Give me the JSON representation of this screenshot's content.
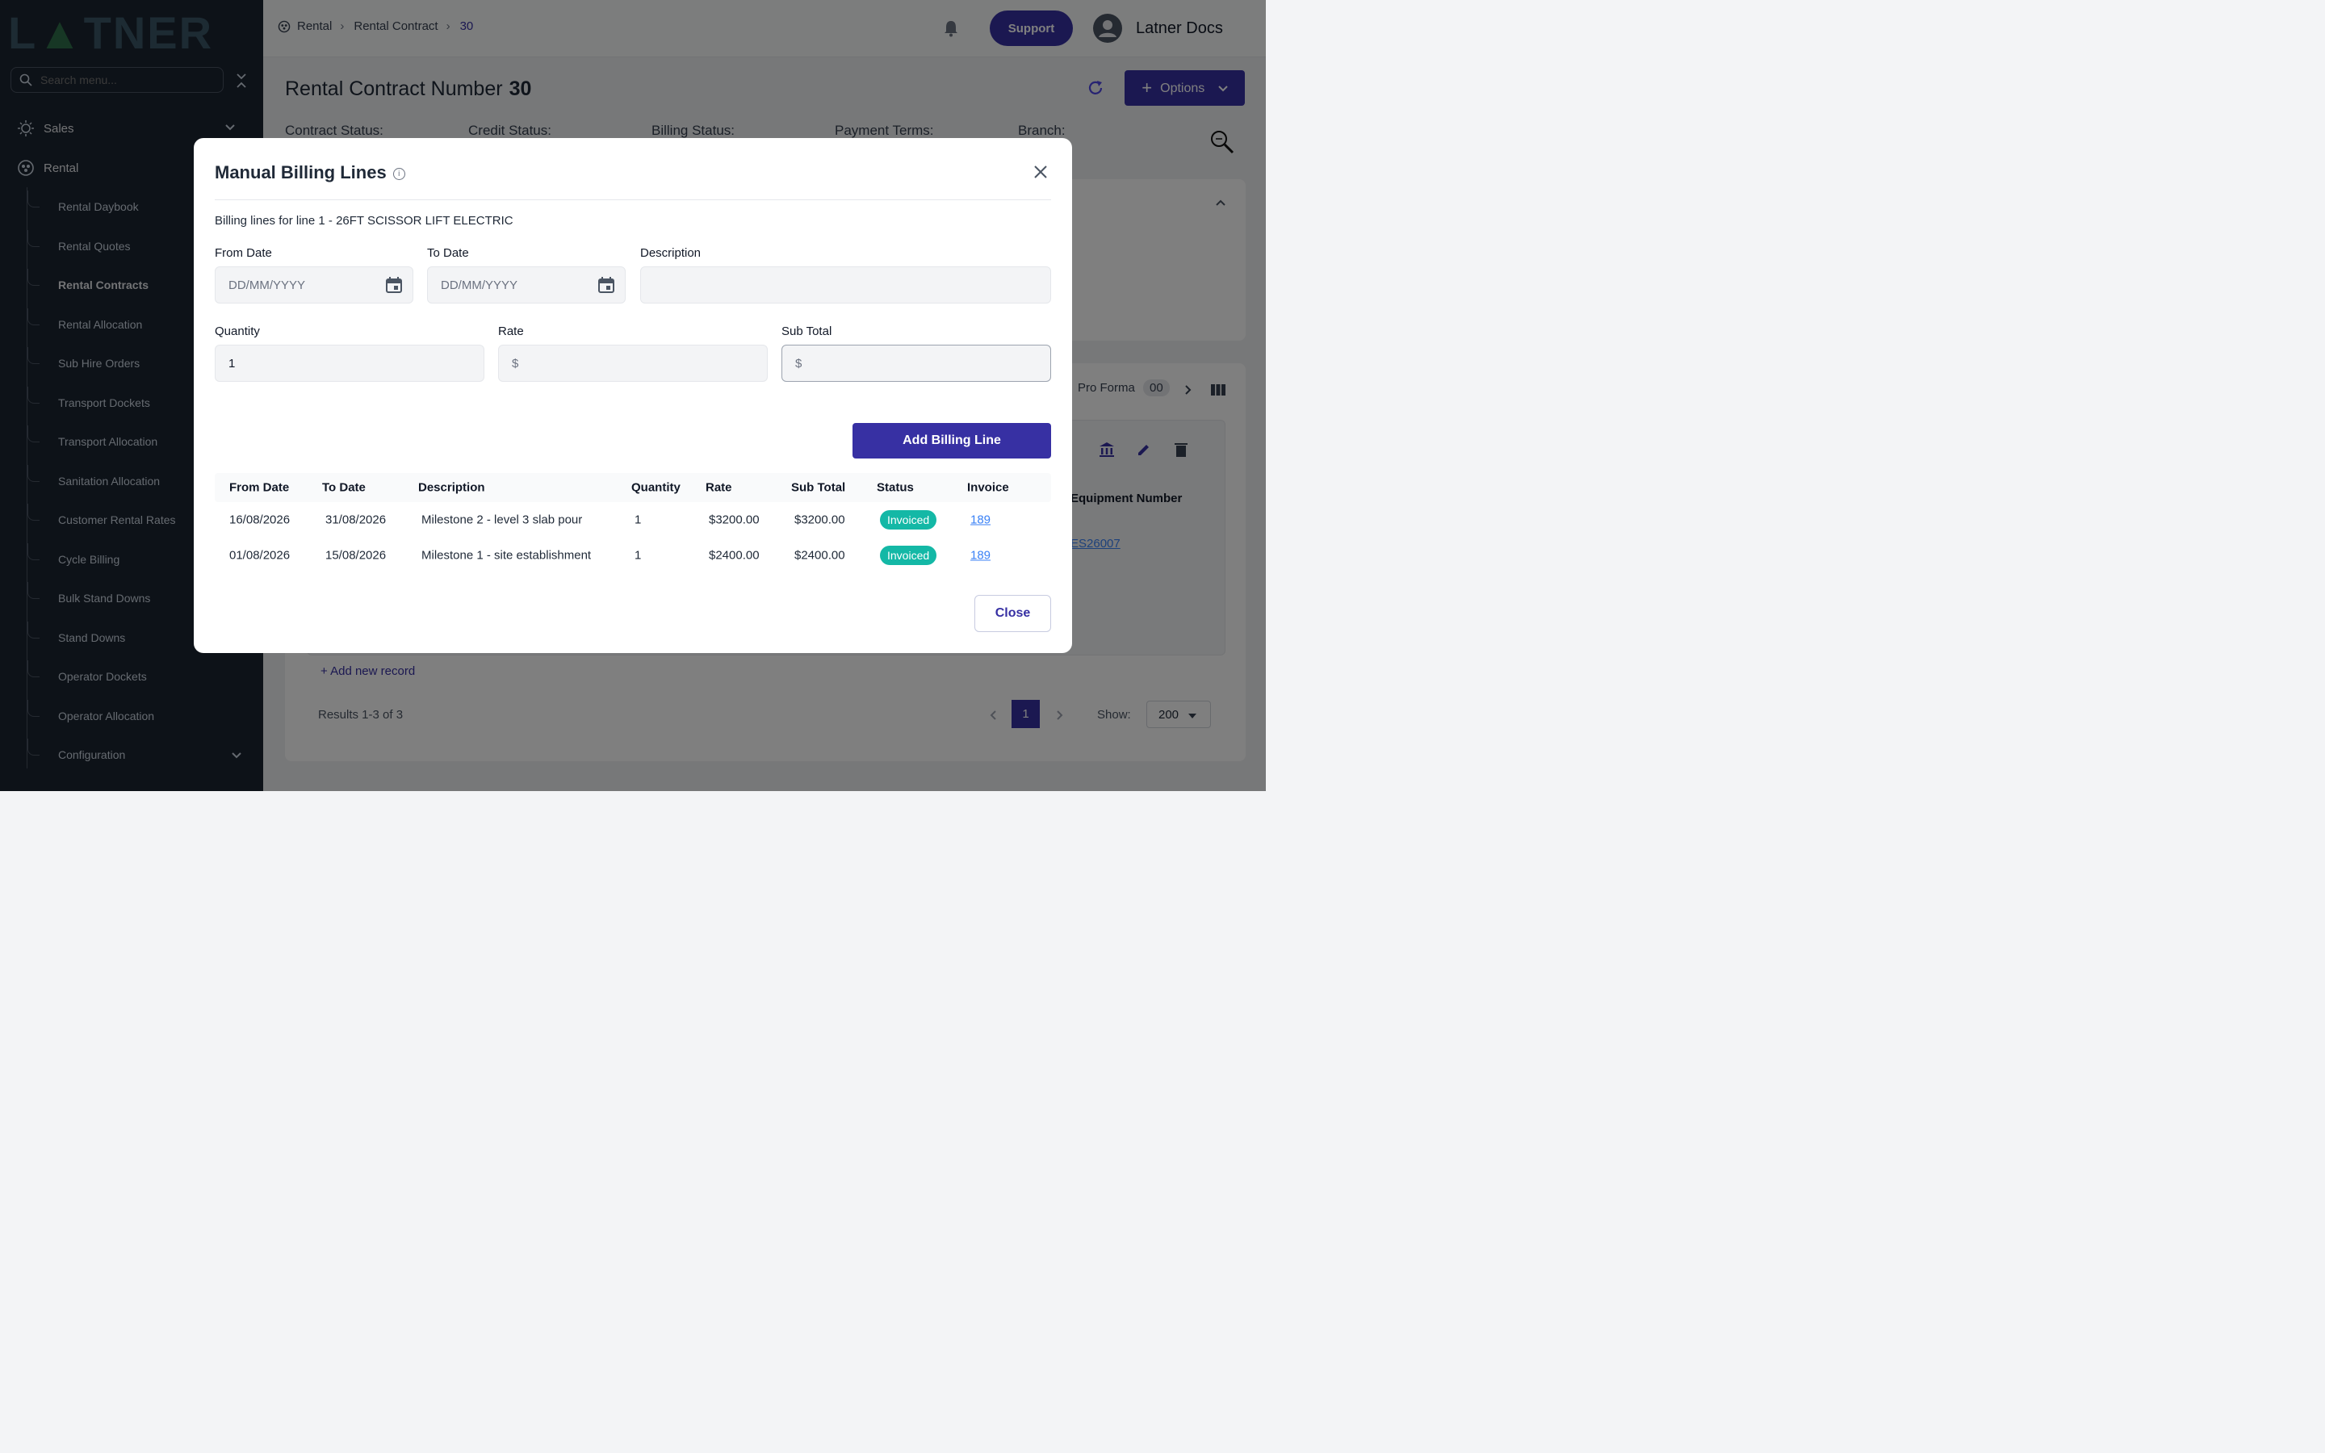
{
  "sidebar": {
    "logo": "LATNER",
    "search_placeholder": "Search menu...",
    "top_items": [
      {
        "label": "Sales"
      },
      {
        "label": "Rental"
      }
    ],
    "sub_items": [
      {
        "label": "Rental Daybook"
      },
      {
        "label": "Rental Quotes"
      },
      {
        "label": "Rental Contracts"
      },
      {
        "label": "Rental Allocation"
      },
      {
        "label": "Sub Hire Orders"
      },
      {
        "label": "Transport Dockets"
      },
      {
        "label": "Transport Allocation"
      },
      {
        "label": "Sanitation Allocation"
      },
      {
        "label": "Customer Rental Rates"
      },
      {
        "label": "Cycle Billing"
      },
      {
        "label": "Bulk Stand Downs"
      },
      {
        "label": "Stand Downs"
      },
      {
        "label": "Operator Dockets"
      },
      {
        "label": "Operator Allocation"
      },
      {
        "label": "Configuration"
      }
    ]
  },
  "topbar": {
    "breadcrumb": [
      "Rental",
      "Rental Contract",
      "30"
    ],
    "support_label": "Support",
    "user_label": "Latner Docs"
  },
  "page": {
    "title": "Rental Contract Number",
    "number": "30",
    "options_label": "Options",
    "status_labels": [
      "Contract Status:",
      "Credit Status:",
      "Billing Status:",
      "Payment Terms:",
      "Branch:"
    ],
    "bg_tab": "Pro Forma",
    "bg_tab_count": "00",
    "bg_col_header": "Equipment Number",
    "bg_link": "ES26007",
    "add_record": "+ Add new record",
    "results": "Results 1-3 of 3",
    "page_num": "1",
    "show_label": "Show:",
    "show_value": "200"
  },
  "modal": {
    "title": "Manual Billing Lines",
    "subtitle": "Billing lines for line 1 - 26FT SCISSOR LIFT ELECTRIC",
    "from_date_label": "From Date",
    "from_date_placeholder": "DD/MM/YYYY",
    "to_date_label": "To Date",
    "to_date_placeholder": "DD/MM/YYYY",
    "description_label": "Description",
    "quantity_label": "Quantity",
    "quantity_value": "1",
    "rate_label": "Rate",
    "rate_prefix": "$",
    "subtotal_label": "Sub Total",
    "subtotal_prefix": "$",
    "add_button": "Add Billing Line",
    "close_button": "Close",
    "table": {
      "headers": [
        "From Date",
        "To Date",
        "Description",
        "Quantity",
        "Rate",
        "Sub Total",
        "Status",
        "Invoice"
      ],
      "rows": [
        {
          "from": "16/08/2026",
          "to": "31/08/2026",
          "description": "Milestone 2 - level 3 slab pour",
          "quantity": "1",
          "rate": "$3200.00",
          "subtotal": "$3200.00",
          "status": "Invoiced",
          "invoice": "189"
        },
        {
          "from": "01/08/2026",
          "to": "15/08/2026",
          "description": "Milestone 1 - site establishment",
          "quantity": "1",
          "rate": "$2400.00",
          "subtotal": "$2400.00",
          "status": "Invoiced",
          "invoice": "189"
        }
      ]
    }
  },
  "icons": [
    "search-icon",
    "collapse-icon",
    "sales-icon",
    "rental-icon",
    "chevron-down-icon",
    "bell-icon",
    "avatar-icon",
    "refresh-icon",
    "plus-icon",
    "zoom-icon",
    "info-icon",
    "close-icon",
    "calendar-icon"
  ],
  "colors": {
    "primary": "#3730a3",
    "badge": "#14b8a6",
    "sidebar": "#1b2430",
    "link": "#3b82f6"
  }
}
